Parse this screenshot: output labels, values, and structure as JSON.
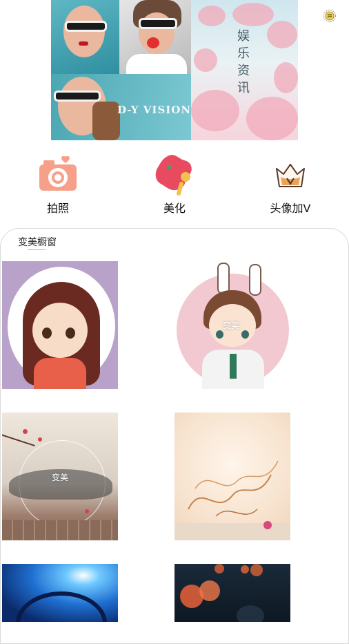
{
  "banner": {
    "left_caption": "D-Y VISION",
    "right_caption": "娱乐资讯"
  },
  "header": {
    "settings_icon": "settings-icon"
  },
  "nav": {
    "items": [
      {
        "label": "拍照",
        "icon": "camera-icon",
        "color": "#f6a08a"
      },
      {
        "label": "美化",
        "icon": "beauty-icon",
        "color": "#e84a5f"
      },
      {
        "label": "头像加V",
        "icon": "crown-v-icon",
        "color": "#d9a05a"
      }
    ]
  },
  "gallery": {
    "title": "变美橱窗",
    "items": [
      {
        "label": "",
        "kind": "cartoon-girl"
      },
      {
        "label": "变美",
        "kind": "cartoon-boy"
      },
      {
        "label": "变美",
        "kind": "ink-landscape"
      },
      {
        "label": "",
        "kind": "water-splash"
      },
      {
        "label": "",
        "kind": "blue-lens"
      },
      {
        "label": "",
        "kind": "bokeh-lights"
      }
    ]
  }
}
